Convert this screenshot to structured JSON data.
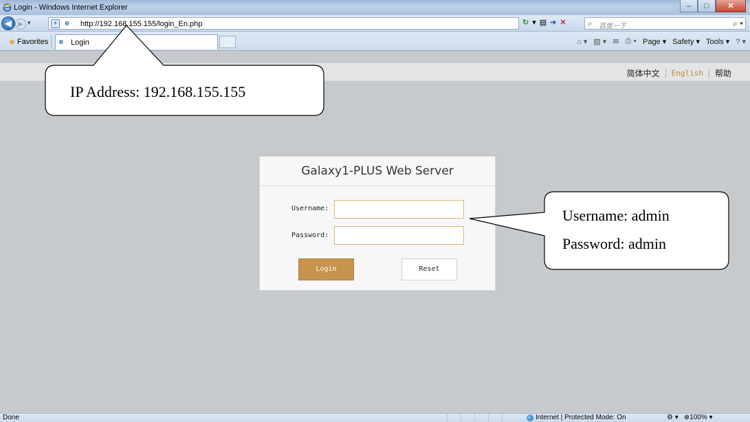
{
  "browser": {
    "window_title": "Login - Windows Internet Explorer",
    "url": "http://192.168.155.155/login_En.php",
    "search_placeholder": "百度一下",
    "favorites_label": "Favorites",
    "tab_label": "Login",
    "menu": {
      "page": "Page ▾",
      "safety": "Safety ▾",
      "tools": "Tools ▾"
    },
    "status": {
      "left": "Done",
      "zone": "Internet | Protected Mode: On",
      "zoom": "100%"
    }
  },
  "page": {
    "languages": {
      "zh": "简体中文",
      "en": "English",
      "help": "帮助"
    },
    "login": {
      "title": "Galaxy1-PLUS Web Server",
      "username_label": "Username:",
      "password_label": "Password:",
      "username_value": "",
      "password_value": "",
      "login_button": "Login",
      "reset_button": "Reset"
    }
  },
  "callouts": {
    "ip": "IP Address: 192.168.155.155",
    "username": "Username: admin",
    "password": "Password: admin"
  },
  "colors": {
    "page_bg": "#c7cacd",
    "accent_gold": "#c6944e",
    "english_link": "#b68a3a"
  }
}
